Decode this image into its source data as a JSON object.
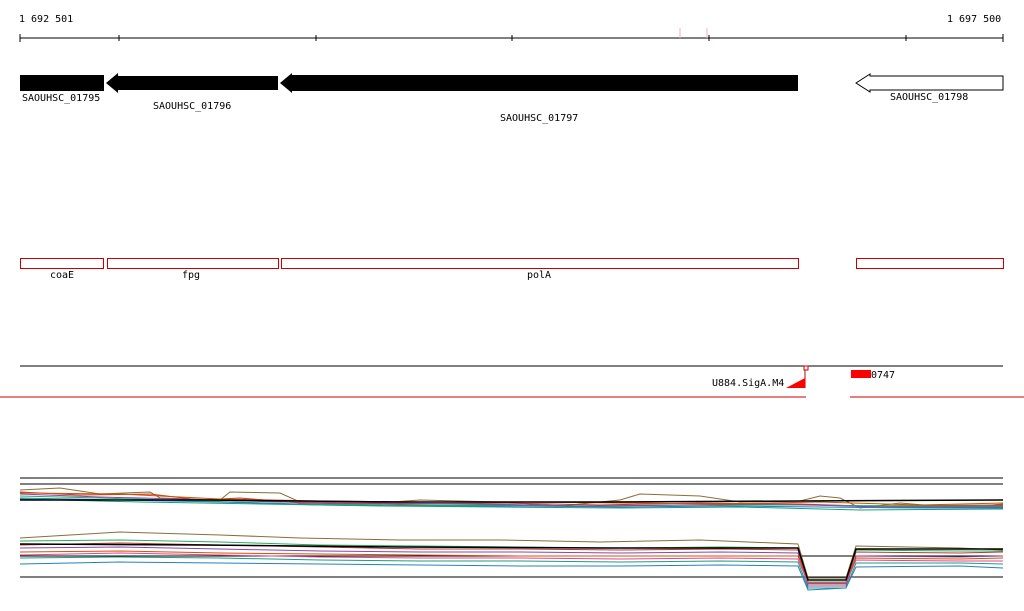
{
  "ruler": {
    "start_label": "1 692 501",
    "end_label": "1 697 500"
  },
  "genes": [
    {
      "label": "SAOUHSC_01795",
      "strand": "minus",
      "filled": true
    },
    {
      "label": "SAOUHSC_01796",
      "strand": "minus",
      "filled": true
    },
    {
      "label": "SAOUHSC_01797",
      "strand": "minus",
      "filled": true
    },
    {
      "label": "SAOUHSC_01798",
      "strand": "minus",
      "filled": false
    }
  ],
  "features": [
    {
      "label": "coaE"
    },
    {
      "label": "fpg"
    },
    {
      "label": "polA"
    },
    {
      "label": ""
    }
  ],
  "sites": [
    {
      "label": "U884.SigA.M4"
    },
    {
      "label": "0747"
    }
  ],
  "colors": {
    "gene_fill": "#000000",
    "feature_outline": "#cc0000",
    "site_mark": "#ff0000",
    "separator": "#cc0000"
  }
}
